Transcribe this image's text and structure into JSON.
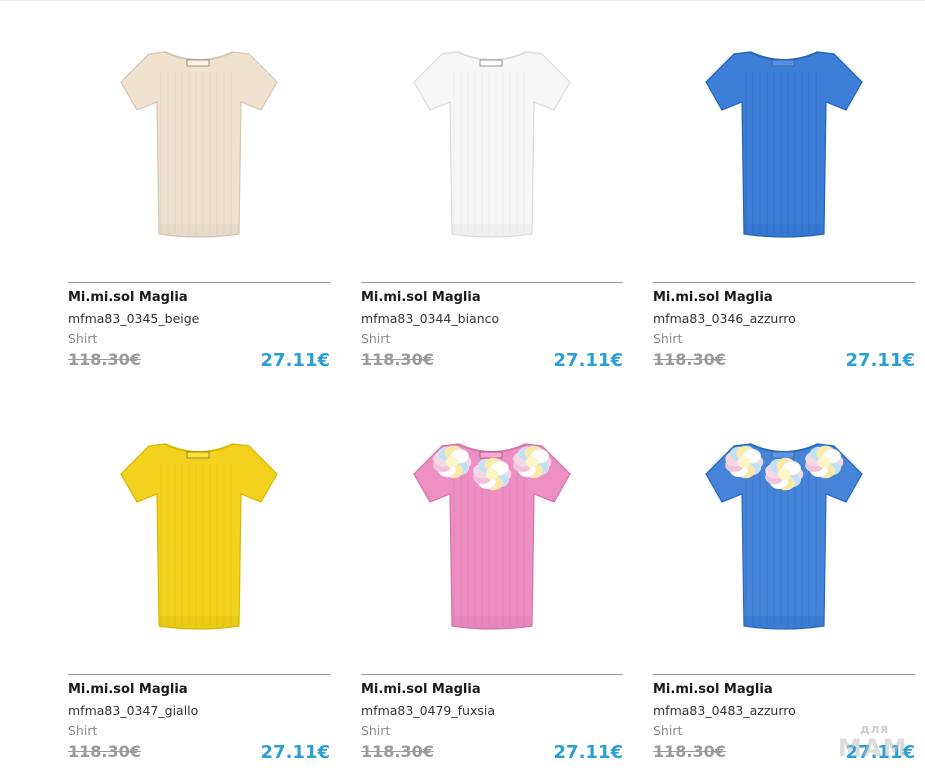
{
  "watermark": {
    "small": "для",
    "big": "МАМ"
  },
  "products": [
    {
      "brand": "Mi.mi.sol Maglia",
      "sku": "mfma83_0345_beige",
      "category": "Shirt",
      "old_price": "118.30€",
      "new_price": "27.11€",
      "color": "#f1e1cf",
      "flowers": false
    },
    {
      "brand": "Mi.mi.sol Maglia",
      "sku": "mfma83_0344_bianco",
      "category": "Shirt",
      "old_price": "118.30€",
      "new_price": "27.11€",
      "color": "#f7f7f7",
      "flowers": false
    },
    {
      "brand": "Mi.mi.sol Maglia",
      "sku": "mfma83_0346_azzurro",
      "category": "Shirt",
      "old_price": "118.30€",
      "new_price": "27.11€",
      "color": "#3d7fd6",
      "flowers": false
    },
    {
      "brand": "Mi.mi.sol Maglia",
      "sku": "mfma83_0347_giallo",
      "category": "Shirt",
      "old_price": "118.30€",
      "new_price": "27.11€",
      "color": "#f2d21e",
      "flowers": false
    },
    {
      "brand": "Mi.mi.sol Maglia",
      "sku": "mfma83_0479_fuxsia",
      "category": "Shirt",
      "old_price": "118.30€",
      "new_price": "27.11€",
      "color": "#ee8fc4",
      "flowers": true
    },
    {
      "brand": "Mi.mi.sol Maglia",
      "sku": "mfma83_0483_azzurro",
      "category": "Shirt",
      "old_price": "118.30€",
      "new_price": "27.11€",
      "color": "#4584d8",
      "flowers": true
    }
  ]
}
